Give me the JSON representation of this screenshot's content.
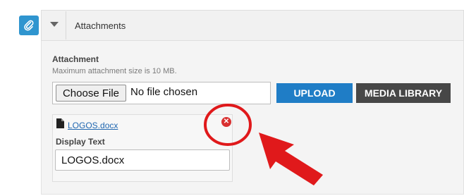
{
  "section": {
    "title": "Attachments"
  },
  "attachment": {
    "label": "Attachment",
    "hint": "Maximum attachment size is 10 MB.",
    "choose_file_label": "Choose File",
    "no_file_text": "No file chosen",
    "upload_label": "UPLOAD",
    "media_library_label": "MEDIA LIBRARY"
  },
  "item": {
    "file_name": "LOGOS.docx",
    "display_label": "Display Text",
    "display_value": "LOGOS.docx",
    "remove_icon": "close-circle-icon"
  },
  "annotation": {
    "color": "#e0191b",
    "highlight": "circle",
    "pointer": "arrow"
  }
}
